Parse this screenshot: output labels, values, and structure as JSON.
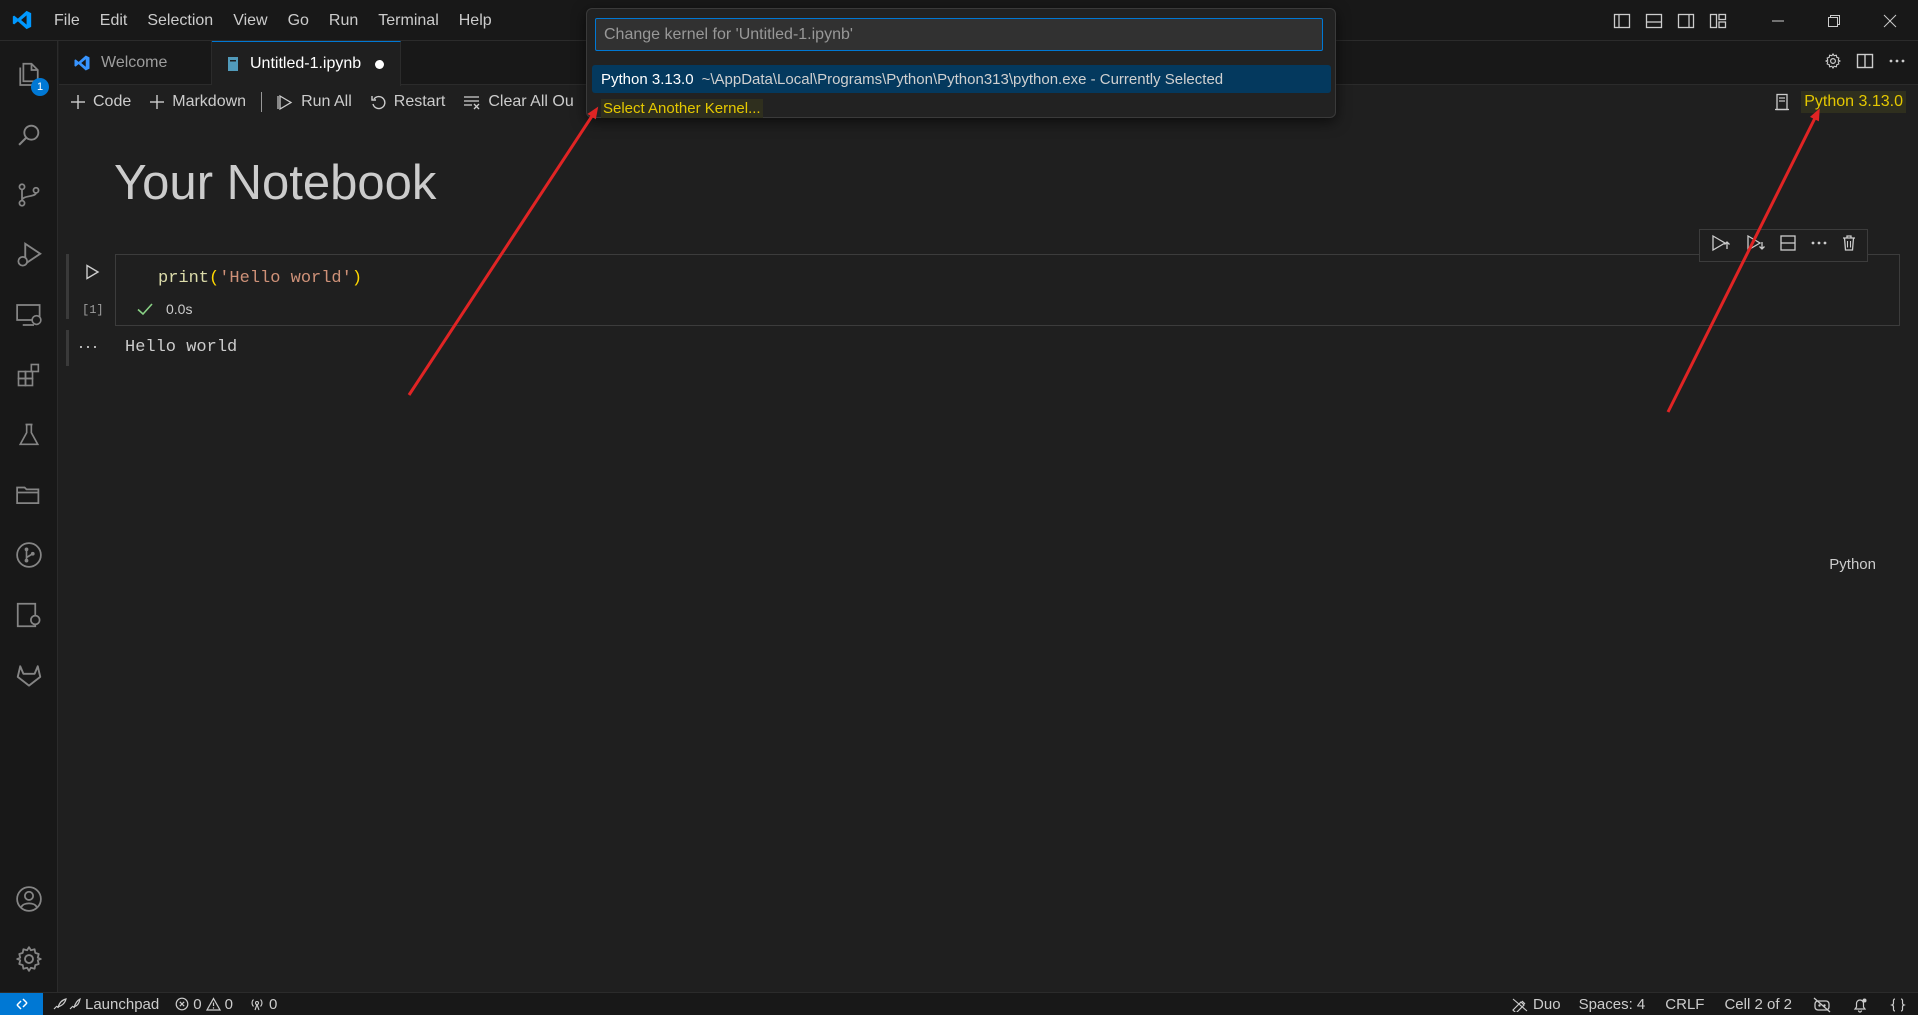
{
  "menu": [
    "File",
    "Edit",
    "Selection",
    "View",
    "Go",
    "Run",
    "Terminal",
    "Help"
  ],
  "activity": {
    "explorer_badge": "1"
  },
  "tabs": [
    {
      "label": "Welcome"
    },
    {
      "label": "Untitled-1.ipynb"
    }
  ],
  "toolbar": {
    "code": "Code",
    "markdown": "Markdown",
    "run_all": "Run All",
    "restart": "Restart",
    "clear_all": "Clear All Ou",
    "kernel": "Python 3.13.0"
  },
  "notebook": {
    "heading": "Your Notebook",
    "cell": {
      "execution_count": "[1]",
      "code_fn": "print",
      "code_open": "(",
      "code_str": "'Hello world'",
      "code_close": ")",
      "duration": "0.0s",
      "language": "Python",
      "output_more": "···",
      "output": "Hello world"
    }
  },
  "quickpick": {
    "placeholder": "Change kernel for 'Untitled-1.ipynb'",
    "items": [
      {
        "label": "Python 3.13.0",
        "description": "~\\AppData\\Local\\Programs\\Python\\Python313\\python.exe - Currently Selected"
      },
      {
        "label": "Select Another Kernel..."
      }
    ]
  },
  "statusbar": {
    "launchpad": "Launchpad",
    "errors": "0",
    "warnings": "0",
    "ports": "0",
    "duo": "Duo",
    "spaces": "Spaces: 4",
    "eol": "CRLF",
    "cell_position": "Cell 2 of 2"
  },
  "colors": {
    "accent": "#0078d4",
    "annotation_arrow": "#e02424",
    "highlight_text": "#e5c800"
  }
}
